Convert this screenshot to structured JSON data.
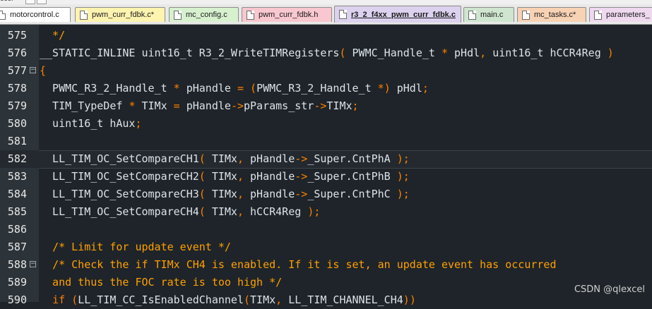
{
  "window": {
    "title_fragment": "ocel"
  },
  "tabs": [
    {
      "label": "motorcontrol.c",
      "color": "#ffffff"
    },
    {
      "label": "pwm_curr_fdbk.c*",
      "color": "#fff3b0"
    },
    {
      "label": "mc_config.c",
      "color": "#d7f1cf"
    },
    {
      "label": "pwm_curr_fdbk.h",
      "color": "#f8c7cf"
    },
    {
      "label": "r3_2_f4xx_pwm_curr_fdbk.c",
      "color": "#dcd2ef",
      "active": true
    },
    {
      "label": "main.c",
      "color": "#cfe5cf"
    },
    {
      "label": "mc_tasks.c*",
      "color": "#f7d2b4"
    },
    {
      "label": "parameters_",
      "color": "#efd9ef"
    }
  ],
  "editor": {
    "lines": [
      {
        "number": "575",
        "text": "  */"
      },
      {
        "number": "576",
        "text": "__STATIC_INLINE uint16_t R3_2_WriteTIMRegisters( PWMC_Handle_t * pHdl, uint16_t hCCR4Reg )"
      },
      {
        "number": "577",
        "text": "{",
        "fold": "−"
      },
      {
        "number": "578",
        "text": "  PWMC_R3_2_Handle_t * pHandle = (PWMC_R3_2_Handle_t *) pHdl;"
      },
      {
        "number": "579",
        "text": "  TIM_TypeDef * TIMx = pHandle->pParams_str->TIMx;"
      },
      {
        "number": "580",
        "text": "  uint16_t hAux;"
      },
      {
        "number": "581",
        "text": ""
      },
      {
        "number": "582",
        "text": "  LL_TIM_OC_SetCompareCH1( TIMx, pHandle->_Super.CntPhA );",
        "current": true
      },
      {
        "number": "583",
        "text": "  LL_TIM_OC_SetCompareCH2( TIMx, pHandle->_Super.CntPhB );"
      },
      {
        "number": "584",
        "text": "  LL_TIM_OC_SetCompareCH3( TIMx, pHandle->_Super.CntPhC );"
      },
      {
        "number": "585",
        "text": "  LL_TIM_OC_SetCompareCH4( TIMx, hCCR4Reg );"
      },
      {
        "number": "586",
        "text": ""
      },
      {
        "number": "587",
        "text": "  /* Limit for update event */"
      },
      {
        "number": "588",
        "text": "  /* Check the if TIMx CH4 is enabled. If it is set, an update event has occurred",
        "fold": "−"
      },
      {
        "number": "589",
        "text": "  and thus the FOC rate is too high */"
      },
      {
        "number": "590",
        "text": "  if (LL_TIM_CC_IsEnabledChannel(TIMx, LL_TIM_CHANNEL_CH4))"
      }
    ]
  },
  "watermark": "CSDN @qlexcel"
}
